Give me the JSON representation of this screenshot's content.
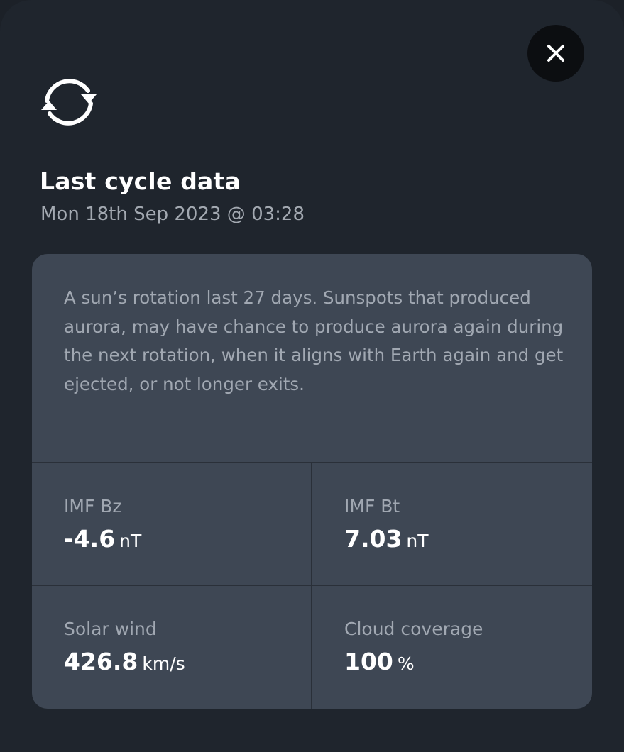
{
  "header": {
    "close_icon": "close-icon",
    "cycle_icon": "cycle-arrows-icon",
    "title": "Last cycle data",
    "subtitle": "Mon 18th Sep 2023 @ 03:28"
  },
  "card": {
    "description": "A sun’s rotation last 27 days. Sunspots that produced aurora, may have chance to produce aurora again during the next rotation, when it aligns with Earth again and get ejected, or not longer exits.",
    "stats": [
      {
        "label": "IMF Bz",
        "value": "-4.6",
        "unit": "nT"
      },
      {
        "label": "IMF Bt",
        "value": "7.03",
        "unit": "nT"
      },
      {
        "label": "Solar wind",
        "value": "426.8",
        "unit": "km/s"
      },
      {
        "label": "Cloud coverage",
        "value": "100",
        "unit": "%"
      }
    ]
  },
  "colors": {
    "background": "#1f252d",
    "card": "#3e4754",
    "close_button": "#0c0e11",
    "text_primary": "#ffffff",
    "text_secondary": "#a1a8b2"
  }
}
